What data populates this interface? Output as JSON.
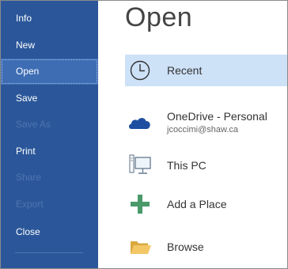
{
  "sidebar": {
    "items": [
      {
        "label": "Info",
        "state": "normal"
      },
      {
        "label": "New",
        "state": "normal"
      },
      {
        "label": "Open",
        "state": "selected"
      },
      {
        "label": "Save",
        "state": "normal"
      },
      {
        "label": "Save As",
        "state": "disabled"
      },
      {
        "label": "Print",
        "state": "normal"
      },
      {
        "label": "Share",
        "state": "disabled"
      },
      {
        "label": "Export",
        "state": "disabled"
      },
      {
        "label": "Close",
        "state": "normal"
      }
    ]
  },
  "main": {
    "title": "Open",
    "places": [
      {
        "label": "Recent",
        "icon": "clock-icon",
        "selected": true
      },
      {
        "label": "OneDrive - Personal",
        "sub": "jcoccimi@shaw.ca",
        "icon": "onedrive-cloud-icon"
      },
      {
        "label": "This PC",
        "icon": "computer-icon"
      },
      {
        "label": "Add a Place",
        "icon": "plus-icon"
      },
      {
        "label": "Browse",
        "icon": "folder-icon"
      }
    ]
  },
  "colors": {
    "sidebar_bg": "#2b579a",
    "sidebar_selected": "#3e6db4",
    "place_selected": "#cde1f7",
    "onedrive_blue": "#1e4fa0",
    "plus_green": "#4a9a6a",
    "folder_yellow": "#f3c766"
  }
}
